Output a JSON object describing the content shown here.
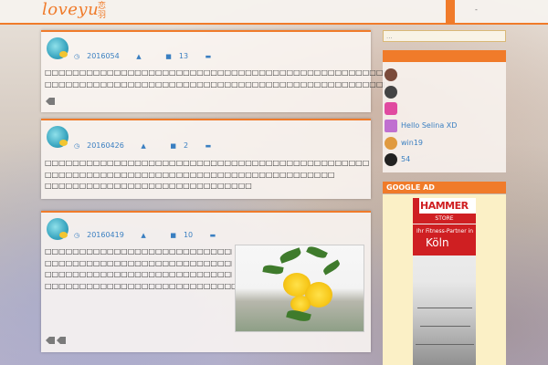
{
  "header": {
    "logo_text": "loveyu",
    "logo_cn": "恋羽",
    "nav_more": "-"
  },
  "posts": [
    {
      "date": "2016054",
      "author": "",
      "comments": "13",
      "category": "",
      "lines": [
        "□□□□□□□□□□□□□□□□□□□□□□□□□□□□□□□□□□□□□□□□□□□□□□□□□□□□□□□□□□□□□□□□□□□□□",
        "□□□□□□□□□□□□□□□□□□□□□□□□□□□□□□□□□□□□□□□□□□□□□□□□□□□□…"
      ]
    },
    {
      "date": "20160426",
      "author": "",
      "comments": "2",
      "category": "",
      "lines": [
        "□□□□□□□□□□□□□□□□□□□□□□□□□□□□□□□□□□□□□□□□□□□□□□□□□□□□□□",
        "□□□□□□□□□□□□□□□□□□□□□□□□□□□□□□□□□□□□□□□□□□",
        "□□□□□□□□□□□□□□□□□□□□□□□□□□□□□□"
      ]
    },
    {
      "date": "20160419",
      "author": "",
      "comments": "10",
      "category": "",
      "lines": [
        "□□□□□□□□□□□□□□□□□□□□□□□□□□□□□",
        "□□□□□□□□□□□□□□□□□□□□□□□□□□□□□□□□□□□□□□□□□",
        "□□□□□□□□□□□□□□□□□□□□□□□□□□□□□□□□□□□□□□",
        "□□□□□□□□□□□□□□□□□□□□□□□□□□□□□□□□□□□□□□□□□□□□□□□□□□□□□□□□□□□□□□□"
      ]
    }
  ],
  "sidebar": {
    "search_placeholder": "...",
    "users": [
      {
        "name": "",
        "color": "#7a4a3a"
      },
      {
        "name": "",
        "color": "#444444"
      },
      {
        "name": "",
        "color": "#e04aa0"
      },
      {
        "name": "Hello Selina XD",
        "color": "#c070d0"
      },
      {
        "name": "win19",
        "color": "#e09a40"
      },
      {
        "name": "54",
        "color": "#222222"
      }
    ],
    "ad_title": "GOOGLE AD",
    "ad": {
      "brand": "HAMMER",
      "store": "STORE",
      "line1": "Ihr Fitness-Partner in",
      "city": "Köln"
    }
  },
  "colors": {
    "accent": "#f07b2a",
    "link": "#3a7fc1"
  }
}
